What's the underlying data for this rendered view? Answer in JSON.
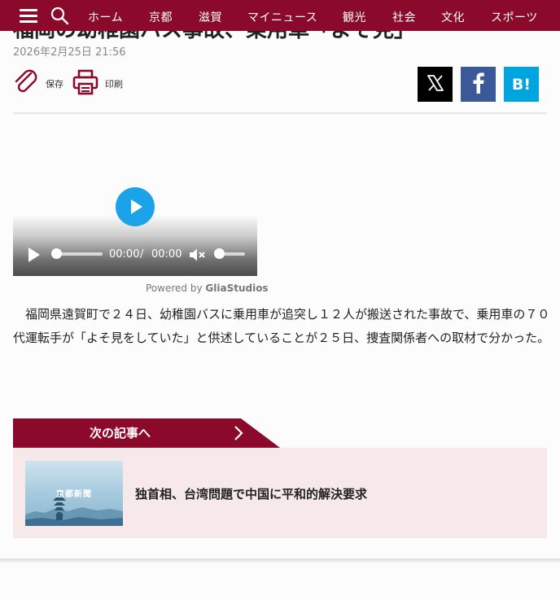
{
  "header": {
    "nav": [
      "ホーム",
      "京都",
      "滋賀",
      "マイニュース",
      "観光",
      "社会",
      "文化",
      "スポーツ"
    ]
  },
  "article": {
    "title": "福岡の幼稚園バス事故、乗用車「よそ見」",
    "date": "2026年2月25日 21:56",
    "body": "福岡県遠賀町で２４日、幼稚園バスに乗用車が追突し１２人が搬送された事故で、乗用車の７０代運転手が「よそ見をしていた」と供述していることが２５日、捜査関係者への取材で分かった。"
  },
  "tools": {
    "save_label": "保存",
    "print_label": "印刷",
    "hatena_label": "B!"
  },
  "video": {
    "current_time": "00:00",
    "separator": "/",
    "duration": "00:00",
    "progress": 0,
    "volume": 0,
    "powered_prefix": "Powered by",
    "powered_brand": "GliaStudios"
  },
  "next": {
    "header_label": "次の記事へ",
    "thumb_text": "京都新聞",
    "title": "独首相、台湾問題で中国に平和的解決要求"
  },
  "colors": {
    "brand": "#8b0a2b",
    "play": "#1aa3e8",
    "facebook": "#3b5998",
    "hatena": "#00a4de",
    "card": "#f7e9ea"
  }
}
